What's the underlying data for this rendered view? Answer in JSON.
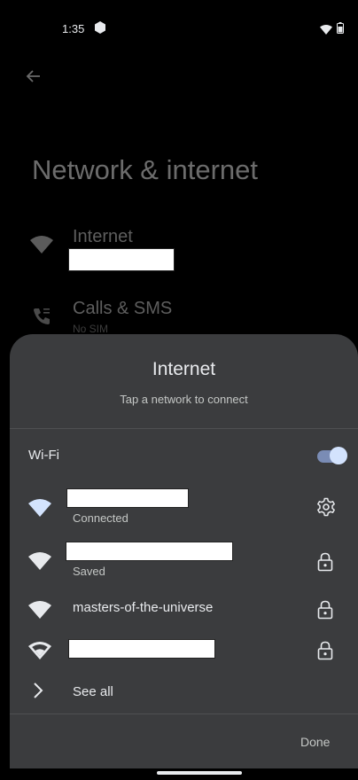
{
  "status_bar": {
    "time": "1:35",
    "icons": [
      "notification-shield-icon",
      "wifi-icon",
      "battery-icon"
    ]
  },
  "background_page": {
    "title": "Network & internet",
    "items": [
      {
        "label": "Internet",
        "icon": "wifi-icon"
      },
      {
        "label": "Calls & SMS",
        "sub": "No SIM",
        "icon": "calls-sms-icon"
      }
    ]
  },
  "sheet": {
    "title": "Internet",
    "subtitle": "Tap a network to connect",
    "wifi_label": "Wi-Fi",
    "wifi_enabled": true,
    "networks": [
      {
        "name": "",
        "status": "Connected",
        "action_icon": "settings-gear-icon",
        "signal_icon": "wifi-full-icon"
      },
      {
        "name": "",
        "status": "Saved",
        "action_icon": "lock-icon",
        "signal_icon": "wifi-full-icon"
      },
      {
        "name": "masters-of-the-universe",
        "status": "",
        "action_icon": "lock-icon",
        "signal_icon": "wifi-full-icon"
      },
      {
        "name": "",
        "status": "",
        "action_icon": "lock-icon",
        "signal_icon": "wifi-partial-icon"
      }
    ],
    "see_all": "See all",
    "done": "Done"
  },
  "colors": {
    "sheet_bg": "#3b3c3e",
    "accent": "#d3e3fd",
    "wifi_connected": "#d3e3fd",
    "page_bg": "#000000"
  }
}
